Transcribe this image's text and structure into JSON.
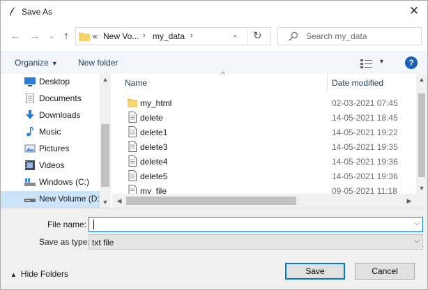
{
  "window": {
    "title": "Save As",
    "close_label": "✕"
  },
  "nav": {
    "back_icon": "←",
    "forward_icon": "→",
    "history_icon": "⌄",
    "up_icon": "↑",
    "address": {
      "overflow": "«",
      "segments": [
        "New Vo...",
        "my_data"
      ],
      "separator": "›",
      "dropdown": "⌄",
      "refresh_icon": "↻"
    },
    "search_placeholder": "Search my_data"
  },
  "toolbar": {
    "organize_label": "Organize",
    "new_folder_label": "New folder",
    "help_label": "?"
  },
  "sidebar": {
    "items": [
      {
        "label": "Desktop",
        "icon": "desktop-icon"
      },
      {
        "label": "Documents",
        "icon": "documents-icon"
      },
      {
        "label": "Downloads",
        "icon": "downloads-icon"
      },
      {
        "label": "Music",
        "icon": "music-icon"
      },
      {
        "label": "Pictures",
        "icon": "pictures-icon"
      },
      {
        "label": "Videos",
        "icon": "videos-icon"
      },
      {
        "label": "Windows (C:)",
        "icon": "drive-icon"
      },
      {
        "label": "New Volume (D:",
        "icon": "drive-icon",
        "selected": true
      }
    ]
  },
  "files": {
    "col_name": "Name",
    "col_date": "Date modified",
    "rows": [
      {
        "name": "my_html",
        "date": "02-03-2021 07:45",
        "type": "folder"
      },
      {
        "name": "delete",
        "date": "14-05-2021 18:45",
        "type": "file"
      },
      {
        "name": "delete1",
        "date": "14-05-2021 19:22",
        "type": "file"
      },
      {
        "name": "delete3",
        "date": "14-05-2021 19:35",
        "type": "file"
      },
      {
        "name": "delete4",
        "date": "14-05-2021 19:36",
        "type": "file"
      },
      {
        "name": "delete5",
        "date": "14-05-2021 19:36",
        "type": "file"
      },
      {
        "name": "my_file",
        "date": "09-05-2021 11:18",
        "type": "file"
      }
    ]
  },
  "form": {
    "file_name_label": "File name:",
    "file_name_value": "",
    "save_type_label": "Save as type:",
    "save_type_value": "txt file"
  },
  "footer": {
    "hide_folders_label": "Hide Folders",
    "save_label": "Save",
    "cancel_label": "Cancel"
  },
  "colors": {
    "accent": "#0078d7",
    "selected_bg": "#cce4f7",
    "folder": "#f2c94c",
    "help_bg": "#1a5fb4"
  }
}
